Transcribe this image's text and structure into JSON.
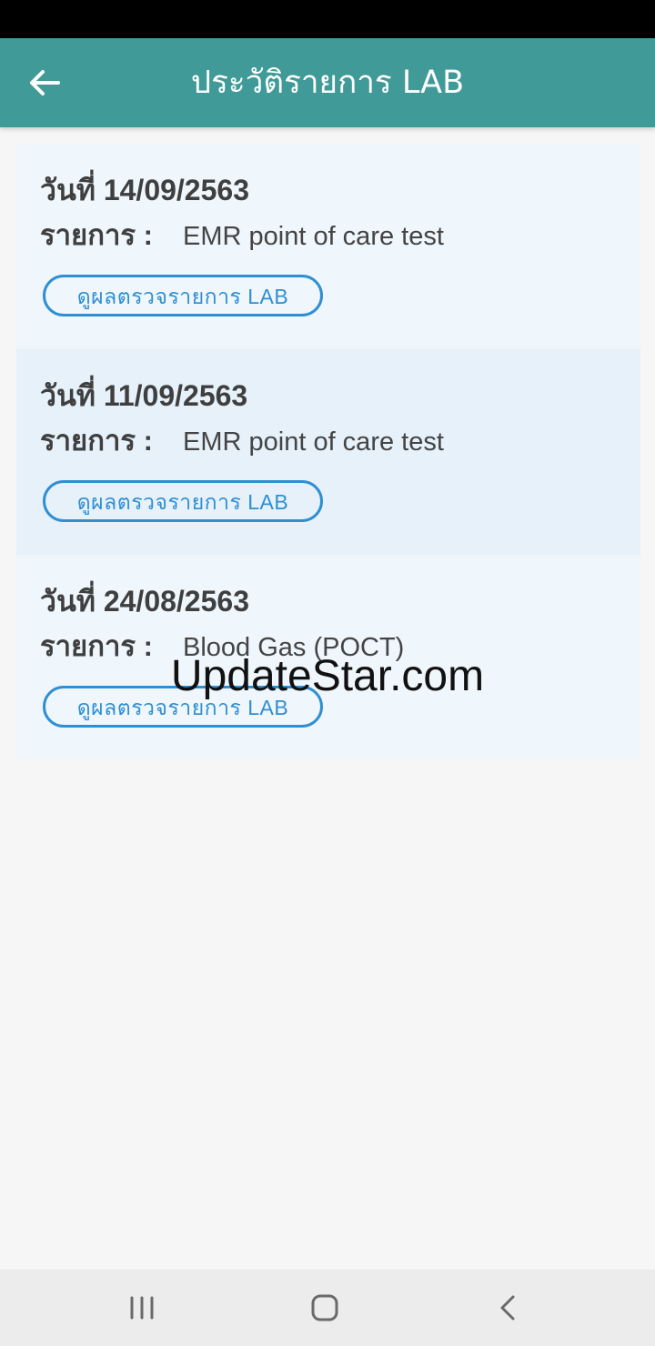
{
  "header": {
    "title": "ประวัติรายการ LAB",
    "back_icon": "arrow-left-icon",
    "background": "#3f9a98"
  },
  "records": [
    {
      "date": "วันที่ 14/09/2563",
      "item_label": "รายการ :",
      "item_value": "EMR point of care test",
      "button_label": "ดูผลตรวจรายการ LAB"
    },
    {
      "date": "วันที่ 11/09/2563",
      "item_label": "รายการ :",
      "item_value": "EMR point of care test",
      "button_label": "ดูผลตรวจรายการ LAB"
    },
    {
      "date": "วันที่ 24/08/2563",
      "item_label": "รายการ :",
      "item_value": "Blood Gas (POCT)",
      "button_label": "ดูผลตรวจรายการ LAB"
    }
  ],
  "watermark": "UpdateStar.com",
  "nav": {
    "recents_icon": "recents-icon",
    "home_icon": "home-icon",
    "back_icon": "nav-back-icon"
  },
  "colors": {
    "accent": "#2f8fd2",
    "card_light": "#eff6fc",
    "card_alt": "#e6f1fa"
  }
}
